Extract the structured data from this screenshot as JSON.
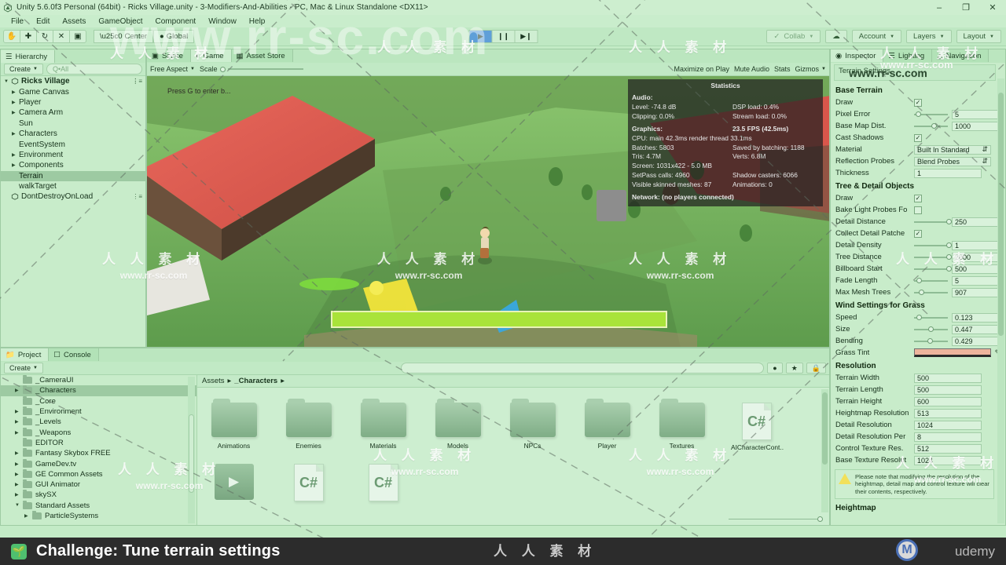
{
  "window": {
    "title": "Unity 5.6.0f3 Personal (64bit) - Ricks Village.unity - 3-Modifiers-And-Abilities - PC, Mac & Linux Standalone <DX11>",
    "minimize": "–",
    "maximize": "❐",
    "close": "✕"
  },
  "menubar": {
    "items": [
      "File",
      "Edit",
      "Assets",
      "GameObject",
      "Component",
      "Window",
      "Help"
    ]
  },
  "toolbar": {
    "transform_tools": [
      {
        "name": "hand-tool",
        "glyph": "✋"
      },
      {
        "name": "move-tool",
        "glyph": "✚"
      },
      {
        "name": "rotate-tool",
        "glyph": "↻"
      },
      {
        "name": "scale-tool",
        "glyph": "✕"
      },
      {
        "name": "rect-tool",
        "glyph": "▣"
      }
    ],
    "pivot_mode": "Center",
    "pivot_rotation": "Global",
    "play": "▶",
    "pause": "❙❙",
    "step": "▶❙",
    "collab": "Collab",
    "cloud": "☁",
    "account": "Account",
    "layers": "Layers",
    "layout": "Layout"
  },
  "hierarchy": {
    "tab": "Hierarchy",
    "create_label": "Create",
    "search_placeholder": "Q•All",
    "items": [
      {
        "label": "Ricks Village",
        "depth": 0,
        "arrow": "▼",
        "scene": true,
        "selected": false,
        "bold": true
      },
      {
        "label": "Game Canvas",
        "depth": 1,
        "arrow": "▶",
        "selected": false
      },
      {
        "label": "Player",
        "depth": 1,
        "arrow": "▶",
        "selected": false
      },
      {
        "label": "Camera Arm",
        "depth": 1,
        "arrow": "▶",
        "selected": false
      },
      {
        "label": "Sun",
        "depth": 1,
        "arrow": "",
        "selected": false
      },
      {
        "label": "Characters",
        "depth": 1,
        "arrow": "▶",
        "selected": false
      },
      {
        "label": "EventSystem",
        "depth": 1,
        "arrow": "",
        "selected": false
      },
      {
        "label": "Environment",
        "depth": 1,
        "arrow": "▶",
        "selected": false
      },
      {
        "label": "Components",
        "depth": 1,
        "arrow": "▶",
        "selected": false
      },
      {
        "label": "Terrain",
        "depth": 1,
        "arrow": "",
        "selected": true
      },
      {
        "label": "walkTarget",
        "depth": 1,
        "arrow": "",
        "selected": false
      },
      {
        "label": "DontDestroyOnLoad",
        "depth": 0,
        "arrow": "",
        "scene": true,
        "selected": false
      }
    ]
  },
  "gameview": {
    "tabs": [
      {
        "label": "Scene",
        "active": false
      },
      {
        "label": "Game",
        "active": true
      },
      {
        "label": "Asset Store",
        "active": false
      }
    ],
    "aspect": "Free Aspect",
    "scale_label": "Scale",
    "maximize_on_play": "Maximize on Play",
    "mute_audio": "Mute Audio",
    "stats": "Stats",
    "gizmos": "Gizmos",
    "hint_text": "Press G to enter b...",
    "health_percent": 100,
    "stats_panel": {
      "title": "Statistics",
      "audio_header": "Audio:",
      "audio_level": "Level: -74.8 dB",
      "audio_clipping": "Clipping: 0.0%",
      "dsp_load": "DSP load: 0.4%",
      "stream_load": "Stream load: 0.0%",
      "graphics_header": "Graphics:",
      "fps": "23.5 FPS (42.5ms)",
      "cpu": "CPU: main 42.3ms   render thread 33.1ms",
      "batches": "Batches: 5803",
      "saved_by_batching": "Saved by batching: 1188",
      "tris": "Tris: 4.7M",
      "verts": "Verts: 6.8M",
      "screen": "Screen: 1031x422 - 5.0 MB",
      "setpass": "SetPass calls: 4960",
      "shadow_casters": "Shadow casters: 6066",
      "skinned_meshes": "Visible skinned meshes: 87",
      "animations": "Animations: 0",
      "network": "Network: (no players connected)"
    }
  },
  "inspector": {
    "tabs": [
      {
        "label": "Inspector",
        "active": true
      },
      {
        "label": "Lighting",
        "active": false
      },
      {
        "label": "Navigation",
        "active": false
      }
    ],
    "header": "Terrain Settings",
    "sections": {
      "base_terrain": {
        "title": "Base Terrain",
        "rows": [
          {
            "label": "Draw",
            "type": "check",
            "value": true
          },
          {
            "label": "Pixel Error",
            "type": "slider",
            "value": "5",
            "pos": 4
          },
          {
            "label": "Base Map Dist.",
            "type": "slider",
            "value": "1000",
            "pos": 52
          },
          {
            "label": "Cast Shadows",
            "type": "check",
            "value": true
          },
          {
            "label": "Material",
            "type": "dropdown",
            "value": "Built In Standard"
          },
          {
            "label": "Reflection Probes",
            "type": "dropdown",
            "value": "Blend Probes"
          },
          {
            "label": "Thickness",
            "type": "field",
            "value": "1"
          }
        ]
      },
      "tree_detail": {
        "title": "Tree & Detail Objects",
        "rows": [
          {
            "label": "Draw",
            "type": "check",
            "value": true
          },
          {
            "label": "Bake Light Probes Fo",
            "type": "check",
            "value": false
          },
          {
            "label": "Detail Distance",
            "type": "slider",
            "value": "250",
            "pos": 96
          },
          {
            "label": "Collect Detail Patche",
            "type": "check",
            "value": true
          },
          {
            "label": "Detail Density",
            "type": "slider",
            "value": "1",
            "pos": 96
          },
          {
            "label": "Tree Distance",
            "type": "slider",
            "value": "2000",
            "pos": 96
          },
          {
            "label": "Billboard Start",
            "type": "slider",
            "value": "500",
            "pos": 96
          },
          {
            "label": "Fade Length",
            "type": "slider",
            "value": "5",
            "pos": 6
          },
          {
            "label": "Max Mesh Trees",
            "type": "slider",
            "value": "907",
            "pos": 14
          }
        ]
      },
      "wind": {
        "title": "Wind Settings for Grass",
        "rows": [
          {
            "label": "Speed",
            "type": "slider",
            "value": "0.123",
            "pos": 8
          },
          {
            "label": "Size",
            "type": "slider",
            "value": "0.447",
            "pos": 42
          },
          {
            "label": "Bending",
            "type": "slider",
            "value": "0.429",
            "pos": 40
          },
          {
            "label": "Grass Tint",
            "type": "color",
            "value": "#edb49c"
          }
        ]
      },
      "resolution": {
        "title": "Resolution",
        "rows": [
          {
            "label": "Terrain Width",
            "type": "field",
            "value": "500"
          },
          {
            "label": "Terrain Length",
            "type": "field",
            "value": "500"
          },
          {
            "label": "Terrain Height",
            "type": "field",
            "value": "600"
          },
          {
            "label": "Heightmap Resolution",
            "type": "field",
            "value": "513"
          },
          {
            "label": "Detail Resolution",
            "type": "field",
            "value": "1024"
          },
          {
            "label": "Detail Resolution Per",
            "type": "field",
            "value": "8"
          },
          {
            "label": "Control Texture Res.",
            "type": "field",
            "value": "512"
          },
          {
            "label": "Base Texture Resolut",
            "type": "field",
            "value": "1024"
          }
        ]
      },
      "warning": "Please note that modifying the resolution of the heightmap, detail map and control texture will clear their contents, respectively.",
      "heightmap_title": "Heightmap"
    }
  },
  "project": {
    "tabs": [
      {
        "label": "Project",
        "active": true
      },
      {
        "label": "Console",
        "active": false
      }
    ],
    "create_label": "Create",
    "tree": [
      {
        "label": "_CameraUI",
        "depth": 1,
        "arrow": "",
        "selected": false
      },
      {
        "label": "_Characters",
        "depth": 1,
        "arrow": "▶",
        "selected": true
      },
      {
        "label": "_Core",
        "depth": 1,
        "arrow": "",
        "selected": false
      },
      {
        "label": "_Environment",
        "depth": 1,
        "arrow": "▶",
        "selected": false
      },
      {
        "label": "_Levels",
        "depth": 1,
        "arrow": "▶",
        "selected": false
      },
      {
        "label": "_Weapons",
        "depth": 1,
        "arrow": "▶",
        "selected": false
      },
      {
        "label": "EDITOR",
        "depth": 1,
        "arrow": "",
        "selected": false
      },
      {
        "label": "Fantasy Skybox FREE",
        "depth": 1,
        "arrow": "▶",
        "selected": false
      },
      {
        "label": "GameDev.tv",
        "depth": 1,
        "arrow": "▶",
        "selected": false
      },
      {
        "label": "GE Common Assets",
        "depth": 1,
        "arrow": "▶",
        "selected": false
      },
      {
        "label": "GUI Animator",
        "depth": 1,
        "arrow": "▶",
        "selected": false
      },
      {
        "label": "skySX",
        "depth": 1,
        "arrow": "▶",
        "selected": false
      },
      {
        "label": "Standard Assets",
        "depth": 1,
        "arrow": "▼",
        "selected": false
      },
      {
        "label": "ParticleSystems",
        "depth": 2,
        "arrow": "▶",
        "selected": false
      }
    ],
    "breadcrumbs": [
      "Assets",
      "_Characters"
    ],
    "search_placeholder": "",
    "assets": [
      {
        "label": "Animations",
        "kind": "folder"
      },
      {
        "label": "Enemies",
        "kind": "folder"
      },
      {
        "label": "Materials",
        "kind": "folder"
      },
      {
        "label": "Models",
        "kind": "folder"
      },
      {
        "label": "NPCs",
        "kind": "folder"
      },
      {
        "label": "Player",
        "kind": "folder"
      },
      {
        "label": "Textures",
        "kind": "folder"
      },
      {
        "label": "AICharacterCont..",
        "kind": "csharp"
      },
      {
        "label": "",
        "kind": "play"
      },
      {
        "label": "",
        "kind": "csharp"
      },
      {
        "label": "",
        "kind": "csharp"
      }
    ]
  },
  "banner": {
    "icon": "🌱",
    "title": "Challenge: Tune terrain settings",
    "brand": "udemy"
  },
  "watermarks": {
    "domain": "www.rr-sc.com",
    "chinese": "人 人 素 材",
    "big": "www.rr-sc.com",
    "logo_letter": "M"
  }
}
